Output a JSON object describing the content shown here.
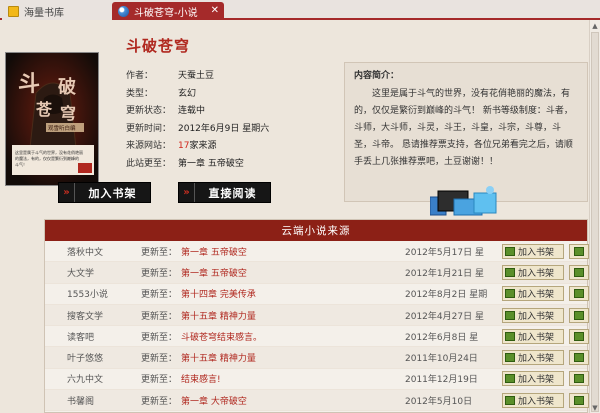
{
  "tabs": [
    {
      "label": "海量书库",
      "active": false
    },
    {
      "label": "斗破苍穹-小说",
      "active": true
    }
  ],
  "book": {
    "title": "斗破苍穹",
    "fields": [
      {
        "key": "作者：",
        "value": "天蚕土豆",
        "highlight": ""
      },
      {
        "key": "类型：",
        "value": "玄幻",
        "highlight": ""
      },
      {
        "key": "更新状态：",
        "value": "连载中",
        "highlight": ""
      },
      {
        "key": "更新时间：",
        "value": "2012年6月9日 星期六",
        "highlight": ""
      },
      {
        "key": "来源网站：",
        "value": "家来源",
        "highlight": "17"
      },
      {
        "key": "此站更至：",
        "value": "第一章 五帝破空",
        "highlight": ""
      }
    ],
    "cover": {
      "big_chars": "斗破苍穹",
      "caption": "观雪听白编",
      "blurb": "这里是属于斗气的世界，没有花俏艳丽的魔法，有的，仅仅是繁衍到巅峰的斗气！"
    }
  },
  "buttons": {
    "add_shelf": "加入书架",
    "read_now": "直接阅读"
  },
  "intro": {
    "heading": "内容简介：",
    "text": "这里是属于斗气的世界，没有花俏艳丽的魔法，有的，仅仅是繁衍到巅峰的斗气！ 新书等级制度：斗者，斗师，大斗师，斗灵，斗王，斗皇，斗宗，斗尊，斗圣，斗帝。 恳请推荐票支持，各位兄弟看完之后，请顺手丢上几张推荐票吧，土豆谢谢！！"
  },
  "sources": {
    "header": "云端小说来源",
    "update_label": "更新至：",
    "add_label": "加入书架",
    "rows": [
      {
        "site": "落秋中文",
        "chapter": "第一章 五帝破空",
        "date": "2012年5月17日 星"
      },
      {
        "site": "大文学",
        "chapter": "第一章 五帝破空",
        "date": "2012年1月21日 星"
      },
      {
        "site": "1553小说",
        "chapter": "第十四章 完美传承",
        "date": "2012年8月2日 星期"
      },
      {
        "site": "搜客文学",
        "chapter": "第十五章 精神力量",
        "date": "2012年4月27日 星"
      },
      {
        "site": "读客吧",
        "chapter": "斗破苍穹结束感言。",
        "date": "2012年6月8日 星"
      },
      {
        "site": "叶子悠悠",
        "chapter": "第十五章 精神力量",
        "date": "2011年10月24日"
      },
      {
        "site": "六九中文",
        "chapter": "结束感言!",
        "date": "2011年12月19日"
      },
      {
        "site": "书馨阁",
        "chapter": "第一章 大帝破空",
        "date": "2012年5月10日"
      }
    ]
  },
  "colors": {
    "accent": "#a52a2a",
    "header_red": "#8c2016",
    "title_red": "#b0281f",
    "background": "#ede6dc"
  }
}
